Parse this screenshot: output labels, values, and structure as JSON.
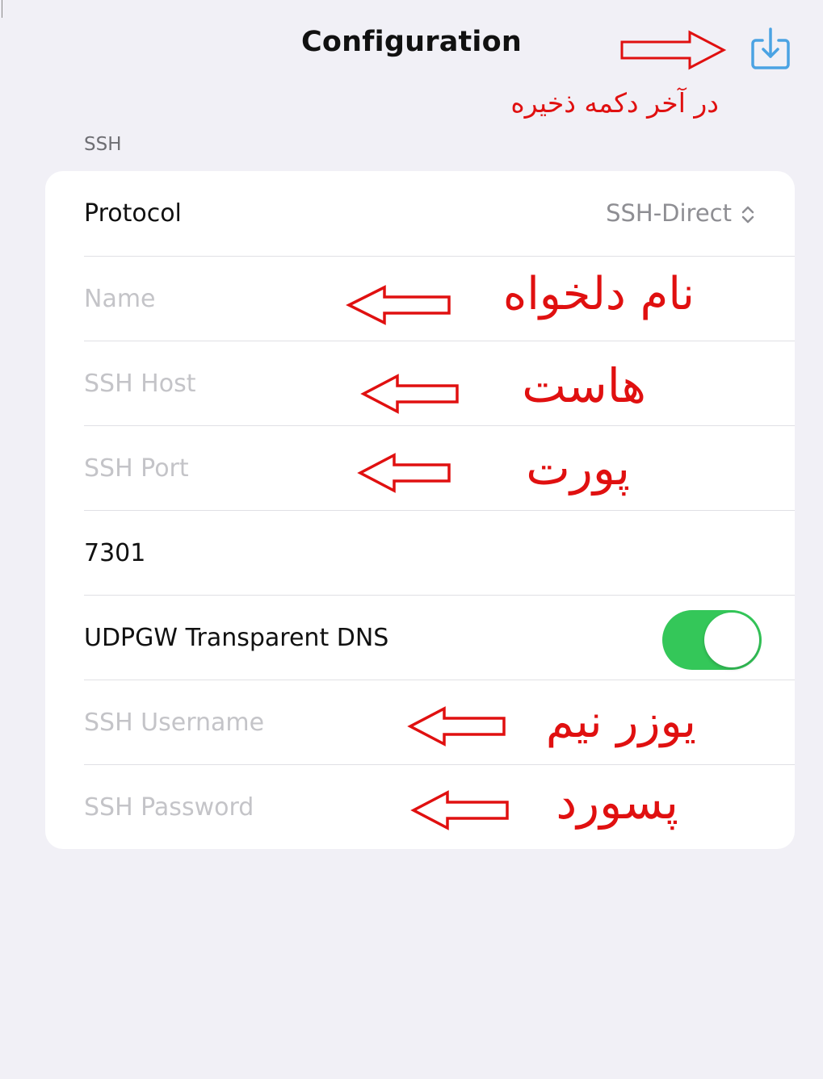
{
  "nav": {
    "title": "Configuration",
    "save_icon": "save-download-icon"
  },
  "section": {
    "header": "SSH"
  },
  "rows": {
    "protocol_label": "Protocol",
    "protocol_value": "SSH-Direct",
    "name_placeholder": "Name",
    "host_placeholder": "SSH Host",
    "port_placeholder": "SSH Port",
    "udpgw_port_value": "7301",
    "udpgw_label": "UDPGW Transparent DNS",
    "udpgw_enabled": true,
    "username_placeholder": "SSH Username",
    "password_placeholder": "SSH Password"
  },
  "annotations": {
    "save_note": "در آخر دکمه ذخیره",
    "name_note": "نام دلخواه",
    "host_note": "هاست",
    "port_note": "پورت",
    "username_note": "یوزر نیم",
    "password_note": "پسورد"
  },
  "colors": {
    "accent": "#4ba3e3",
    "toggle_on": "#34c759",
    "annotation": "#e01010",
    "background": "#f1f0f6"
  }
}
